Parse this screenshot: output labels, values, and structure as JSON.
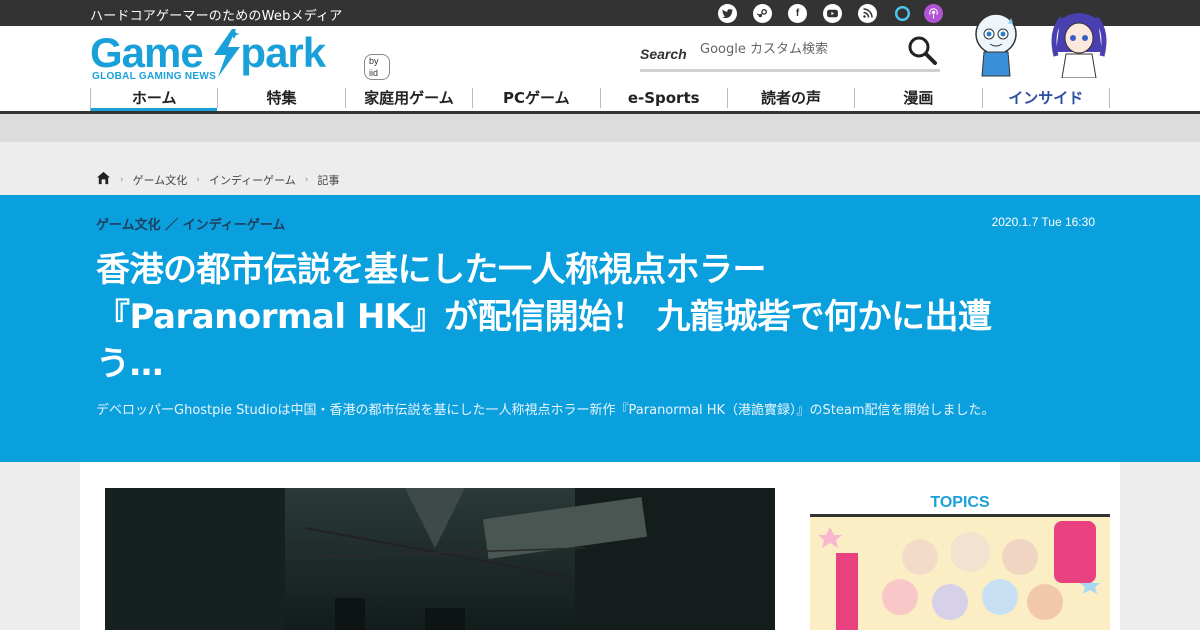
{
  "site": {
    "tagline": "ハードコアゲーマーのためのWebメディア",
    "logo_text": "Game Spark",
    "logo_sub": "GLOBAL GAMING NEWS",
    "logo_by": "by iid",
    "brand_color": "#1aa0d8",
    "hero_color": "#0aa0de"
  },
  "social": [
    {
      "name": "twitter-icon"
    },
    {
      "name": "steam-icon"
    },
    {
      "name": "facebook-icon",
      "glyph": "f"
    },
    {
      "name": "youtube-icon"
    },
    {
      "name": "rss-icon"
    },
    {
      "name": "alexa-icon"
    },
    {
      "name": "podcast-icon"
    }
  ],
  "search": {
    "label": "Search",
    "placeholder": "Google カスタム検索"
  },
  "nav": [
    {
      "label": "ホーム"
    },
    {
      "label": "特集"
    },
    {
      "label": "家庭用ゲーム"
    },
    {
      "label": "PCゲーム"
    },
    {
      "label": "e-Sports"
    },
    {
      "label": "読者の声"
    },
    {
      "label": "漫画"
    },
    {
      "label": "インサイド"
    }
  ],
  "breadcrumb": [
    "ゲーム文化",
    "インディーゲーム",
    "記事"
  ],
  "article": {
    "category": "ゲーム文化 ／ インディーゲーム",
    "date": "2020.1.7 Tue 16:30",
    "title_line1": "香港の都市伝説を基にした一人称視点ホラー",
    "title_line2": "『Paranormal HK』が配信開始！ 九龍城砦で何かに出遭",
    "title_line3": "う…",
    "summary": "デベロッパーGhostpie Studioは中国・香港の都市伝説を基にした一人称視点ホラー新作『Paranormal HK（港詭實録）』のSteam配信を開始しました。"
  },
  "sidebar": {
    "topics_title": "TOPICS"
  }
}
